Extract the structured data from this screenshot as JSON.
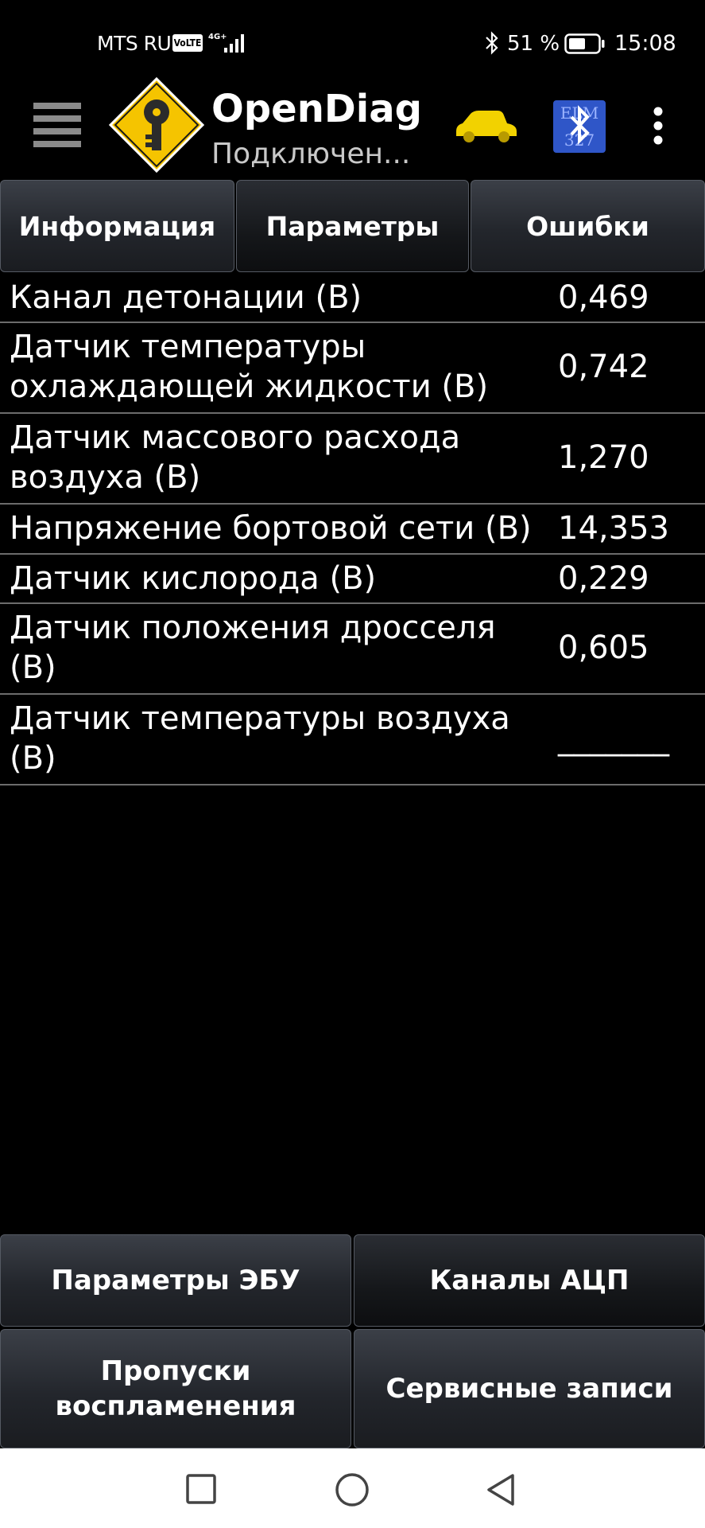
{
  "status_bar": {
    "carrier": "MTS RUS",
    "volte": "VoLTE",
    "network": "4G+",
    "battery_percent": "51 %",
    "time": "15:08"
  },
  "app_bar": {
    "title": "OpenDiag",
    "subtitle": "Подключен...",
    "icons": [
      "menu-icon",
      "key-logo-icon",
      "car-icon",
      "bluetooth-elm327-icon",
      "more-vert-icon"
    ],
    "bt_device_label_top": "ELM",
    "bt_device_label_bottom": "327"
  },
  "tabs": [
    {
      "label": "Информация",
      "active": false
    },
    {
      "label": "Параметры",
      "active": true
    },
    {
      "label": "Ошибки",
      "active": false
    }
  ],
  "parameters": [
    {
      "name_lines": [
        "Канал детонации (В)"
      ],
      "value": "0,469"
    },
    {
      "name_lines": [
        "Датчик температуры",
        "охлаждающей жидкости (В)"
      ],
      "value": "0,742"
    },
    {
      "name_lines": [
        "Датчик массового расхода",
        "воздуха (В)"
      ],
      "value": "1,270"
    },
    {
      "name_lines": [
        "Напряжение бортовой сети (В)"
      ],
      "value": "14,353"
    },
    {
      "name_lines": [
        "Датчик кислорода (В)"
      ],
      "value": "0,229"
    },
    {
      "name_lines": [
        "Датчик положения дросселя",
        "(В)"
      ],
      "value": "0,605"
    },
    {
      "name_lines": [
        "Датчик температуры воздуха",
        "(В)"
      ],
      "value": "_______"
    }
  ],
  "bottom_buttons": {
    "ecu_params": "Параметры ЭБУ",
    "adc_channels": "Каналы АЦП",
    "misfire_line1": "Пропуски",
    "misfire_line2": "воспламенения",
    "service_records": "Сервисные записи"
  },
  "colors": {
    "background": "#000000",
    "logo_yellow": "#f5c400",
    "car_yellow": "#f2d200",
    "bt_blue": "#2f56c8",
    "divider": "#6c6c6c"
  }
}
